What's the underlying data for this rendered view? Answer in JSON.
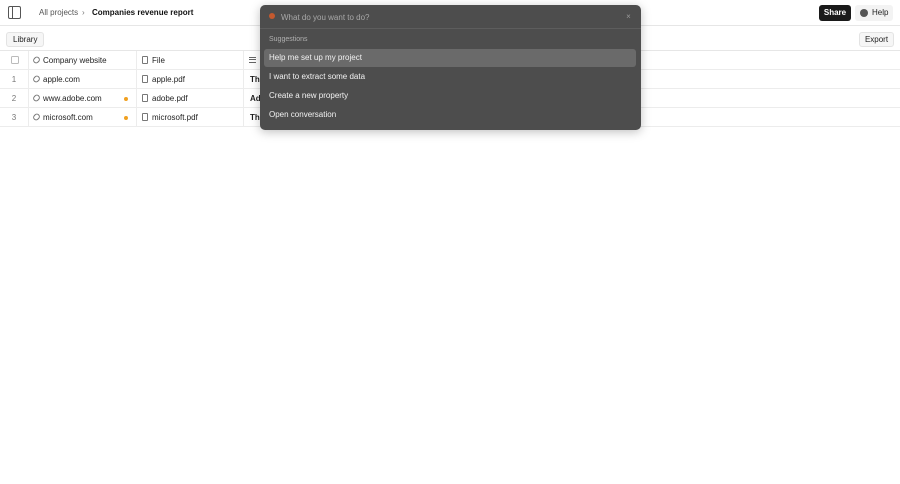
{
  "header": {
    "breadcrumb_root": "All projects",
    "breadcrumb_sep": "›",
    "page_title": "Companies revenue report",
    "share_label": "Share",
    "help_label": "Help"
  },
  "toolbar": {
    "library_label": "Library",
    "export_label": "Export"
  },
  "table": {
    "columns": [
      "Company website",
      "File"
    ],
    "rows": [
      {
        "num": "1",
        "website": "apple.com",
        "file": "apple.pdf",
        "summary": "Th",
        "flag": false
      },
      {
        "num": "2",
        "website": "www.adobe.com",
        "file": "adobe.pdf",
        "summary": "Ad",
        "flag": true
      },
      {
        "num": "3",
        "website": "microsoft.com",
        "file": "microsoft.pdf",
        "summary": "Th",
        "flag": true
      }
    ]
  },
  "palette": {
    "placeholder": "What do you want to do?",
    "close_glyph": "×",
    "section_label": "Suggestions",
    "items": [
      "Help me set up my project",
      "I want to extract some data",
      "Create a new property",
      "Open conversation"
    ]
  },
  "colors": {
    "accent_dot": "#f0a020",
    "palette_bg": "#4d4d4d",
    "search_icon": "#c4592e"
  }
}
